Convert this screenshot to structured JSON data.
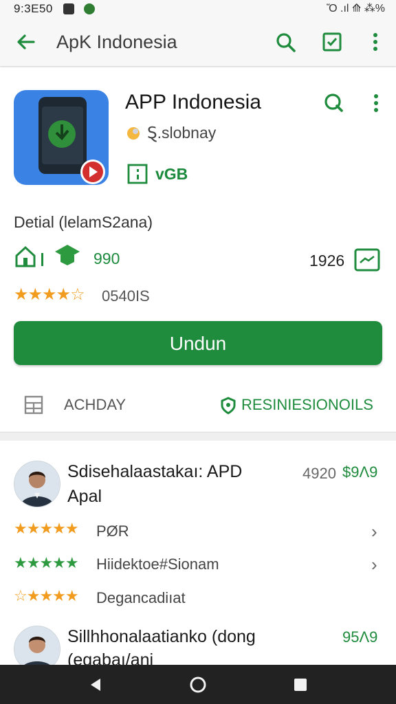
{
  "status": {
    "time": "9:3Ε50",
    "right": "Ὄ .ıl ⟰ ⁂%"
  },
  "appbar": {
    "title": "ApK Indonesia"
  },
  "app": {
    "name": "APP Indonesia",
    "developer": "Ȿ.slobnay",
    "badge": "ᴠGB",
    "detail": "Detial (lelamS2ana)",
    "downloads": "990",
    "size": "1926",
    "rating_text": "0540IS"
  },
  "install": {
    "label": "Undun"
  },
  "tabs": {
    "left": "ACHDAY",
    "right": "RESINIESIONOILS"
  },
  "reviews": [
    {
      "title": "Sdisehalaastakaı: APD",
      "subtitle": "Apal",
      "meta": "4920",
      "price": "$9Λ9"
    },
    {
      "title": "Sillhhonalaatianko (dong",
      "subtitle": "(egabaı/ani",
      "price": "95Λ9"
    }
  ],
  "rows": [
    {
      "text": "PØR"
    },
    {
      "text": "Hiidektoe#Sionam"
    },
    {
      "text": "Degancadiıat"
    }
  ],
  "colors": {
    "accent": "#1f8b3d",
    "icon_bg": "#3a82e4",
    "star": "#f29c1f"
  }
}
